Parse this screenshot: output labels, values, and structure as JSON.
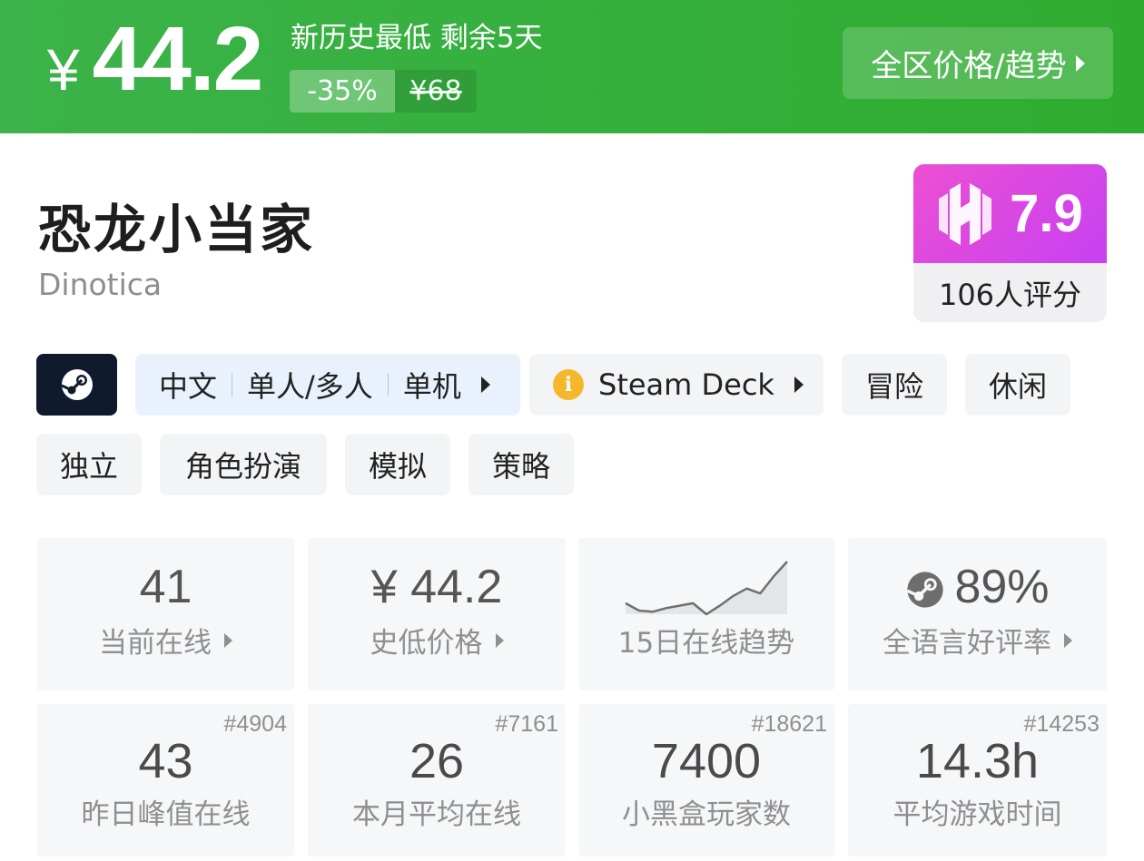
{
  "banner": {
    "currency": "¥",
    "price": "44.2",
    "promo": "新历史最低 剩余5天",
    "discount": "-35%",
    "original_price": "¥68",
    "region_button": "全区价格/趋势"
  },
  "game": {
    "title": "恐龙小当家",
    "subtitle": "Dinotica"
  },
  "score": {
    "value": "7.9",
    "raters": "106人评分"
  },
  "tags": {
    "features": [
      "中文",
      "单人/多人",
      "单机"
    ],
    "deck": "Steam Deck",
    "genres_row1": [
      "冒险",
      "休闲"
    ],
    "genres_row2": [
      "独立",
      "角色扮演",
      "模拟",
      "策略"
    ]
  },
  "stats": {
    "online": {
      "value": "41",
      "label": "当前在线"
    },
    "lowest": {
      "value": "¥ 44.2",
      "label": "史低价格"
    },
    "trend": {
      "label": "15日在线趋势"
    },
    "rating": {
      "value": "89%",
      "label": "全语言好评率"
    },
    "peak": {
      "value": "43",
      "label": "昨日峰值在线",
      "rank": "#4904"
    },
    "monthly": {
      "value": "26",
      "label": "本月平均在线",
      "rank": "#7161"
    },
    "players": {
      "value": "7400",
      "label": "小黑盒玩家数",
      "rank": "#18621"
    },
    "playtime": {
      "value": "14.3h",
      "label": "平均游戏时间",
      "rank": "#14253"
    }
  },
  "colors": {
    "banner_green": "#2fac2f",
    "score_magenta": "#d948e6",
    "deck_info_yellow": "#f5b72b",
    "steam_navy": "#0f1b2d"
  },
  "trend_data": [
    12,
    6,
    5,
    8,
    10,
    12,
    3,
    10,
    18,
    24,
    20,
    34,
    46
  ]
}
